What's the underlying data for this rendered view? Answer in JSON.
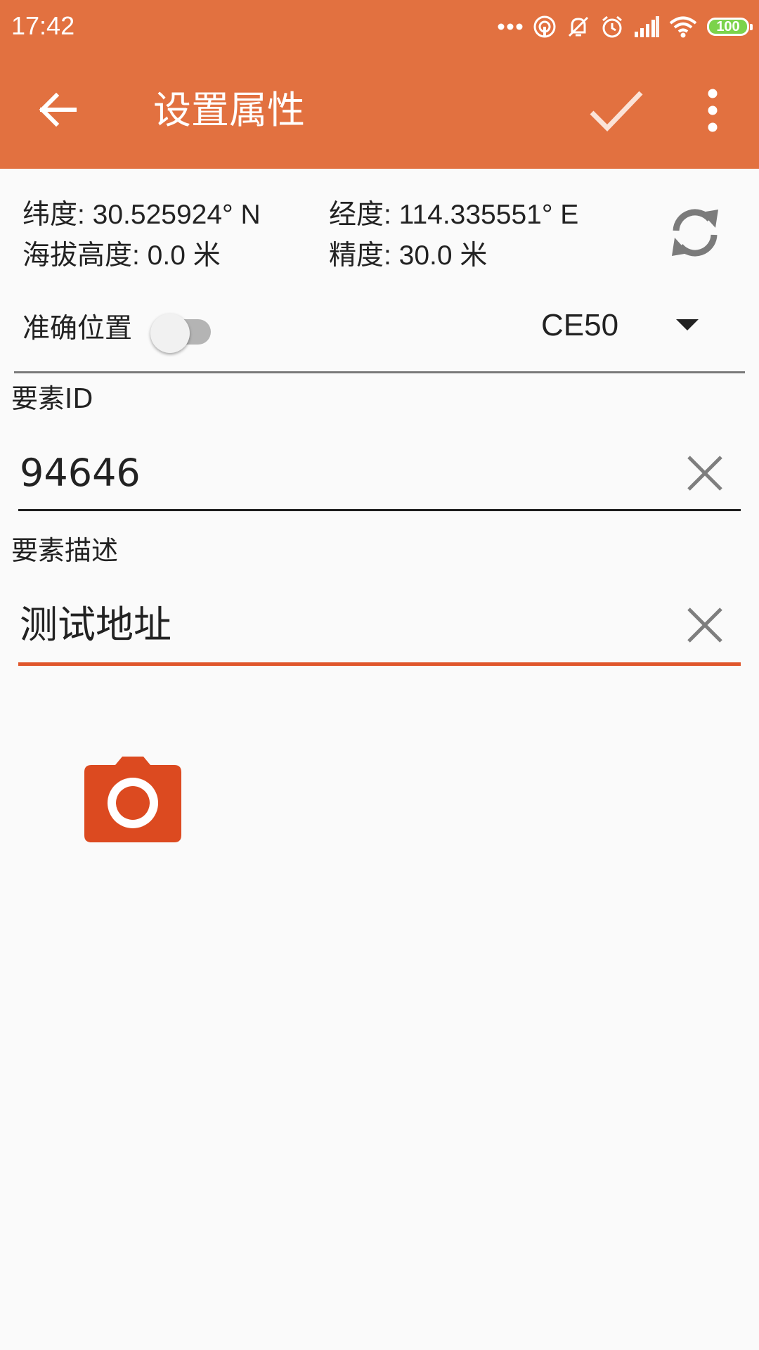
{
  "status_bar": {
    "time": "17:42",
    "battery": "100",
    "icons": [
      "more-dots-icon",
      "hotspot-icon",
      "mute-icon",
      "alarm-icon",
      "signal-icon",
      "wifi-icon",
      "battery-icon"
    ]
  },
  "app_bar": {
    "title": "设置属性",
    "icons": [
      "back-arrow-icon",
      "check-icon",
      "more-vert-icon"
    ]
  },
  "location": {
    "latitude": "纬度: 30.525924° N",
    "longitude": "经度: 114.335551° E",
    "altitude": "海拔高度: 0.0 米",
    "accuracy": "精度: 30.0 米",
    "refresh_icon": "refresh-icon"
  },
  "accurate_position": {
    "label": "准确位置",
    "enabled": false
  },
  "precision_select": {
    "value": "CE50"
  },
  "feature_id": {
    "label": "要素ID",
    "value": "94646"
  },
  "feature_description": {
    "label": "要素描述",
    "value": "测试地址"
  },
  "camera": {
    "icon": "camera-icon"
  },
  "colors": {
    "app_bar": "#e27140",
    "accent": "#e0562b",
    "background": "#fafafa"
  }
}
